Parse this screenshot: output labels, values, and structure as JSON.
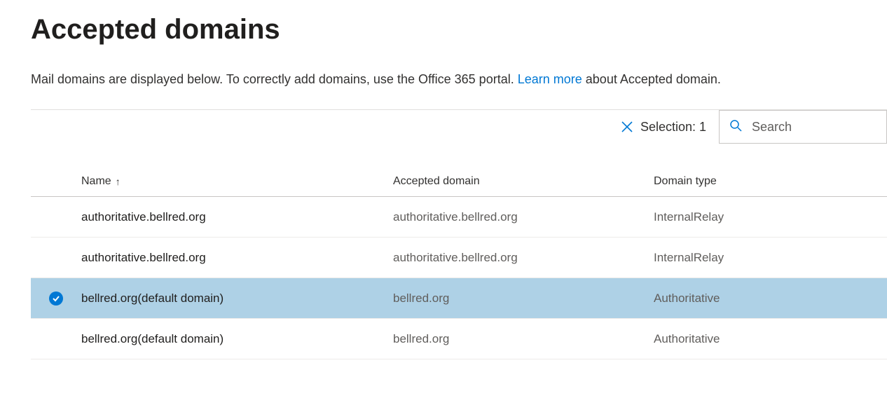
{
  "title": "Accepted domains",
  "description": {
    "before_link": "Mail domains are displayed below. To correctly add domains, use the Office 365 portal. ",
    "link_text": "Learn more",
    "after_link": " about Accepted domain."
  },
  "toolbar": {
    "selection_label": "Selection: 1",
    "search_placeholder": "Search"
  },
  "columns": {
    "name": "Name",
    "accepted_domain": "Accepted domain",
    "domain_type": "Domain type"
  },
  "rows": [
    {
      "selected": false,
      "name": "authoritative.bellred.org",
      "accepted_domain": "authoritative.bellred.org",
      "domain_type": "InternalRelay"
    },
    {
      "selected": false,
      "name": "authoritative.bellred.org",
      "accepted_domain": "authoritative.bellred.org",
      "domain_type": "InternalRelay"
    },
    {
      "selected": true,
      "name": "bellred.org(default domain)",
      "accepted_domain": "bellred.org",
      "domain_type": "Authoritative"
    },
    {
      "selected": false,
      "name": "bellred.org(default domain)",
      "accepted_domain": "bellred.org",
      "domain_type": "Authoritative"
    }
  ]
}
